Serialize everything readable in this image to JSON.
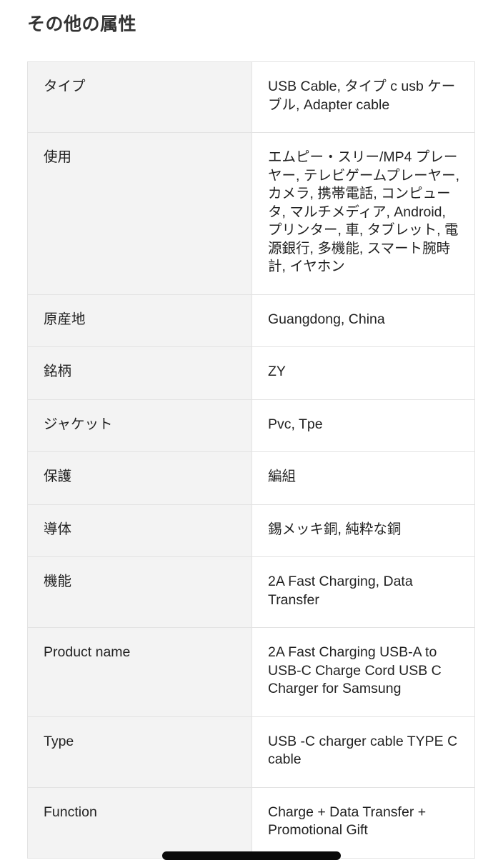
{
  "section": {
    "title": "その他の属性"
  },
  "attributes": [
    {
      "key": "タイプ",
      "value": "USB Cable, タイプ c usb ケーブル, Adapter cable"
    },
    {
      "key": "使用",
      "value": "エムピー・スリー/MP4 プレーヤー, テレビゲームプレーヤー, カメラ, 携帯電話, コンピュータ, マルチメディア, Android, プリンター, 車, タブレット, 電源銀行, 多機能, スマート腕時計, イヤホン"
    },
    {
      "key": "原産地",
      "value": "Guangdong, China"
    },
    {
      "key": "銘柄",
      "value": "ZY"
    },
    {
      "key": "ジャケット",
      "value": "Pvc, Tpe"
    },
    {
      "key": "保護",
      "value": "編組"
    },
    {
      "key": "導体",
      "value": "錫メッキ銅, 純粋な銅"
    },
    {
      "key": "機能",
      "value": "2A Fast Charging, Data Transfer"
    },
    {
      "key": "Product name",
      "value": "2A Fast Charging USB-A to USB-C Charge Cord USB C Charger for Samsung"
    },
    {
      "key": "Type",
      "value": "USB -C charger cable TYPE C cable"
    },
    {
      "key": "Function",
      "value": "Charge + Data Transfer + Promotional Gift"
    }
  ]
}
